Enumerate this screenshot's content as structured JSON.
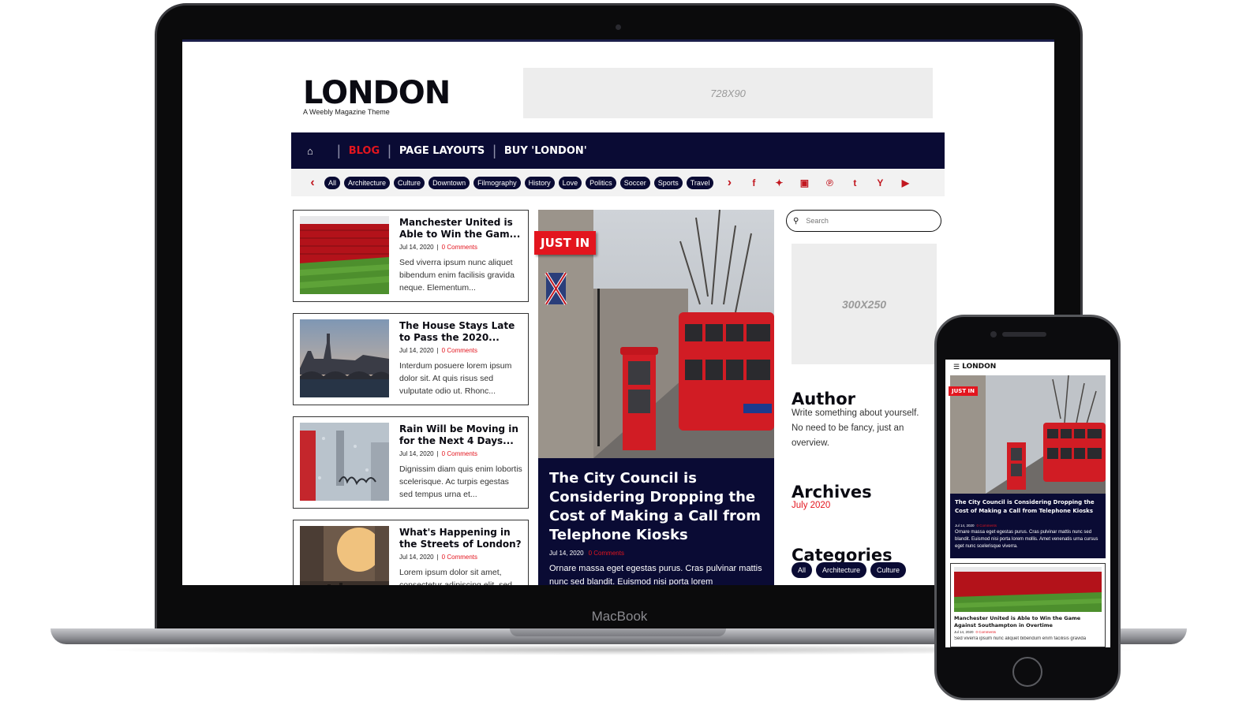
{
  "laptop": {
    "brand_label": "MacBook"
  },
  "site": {
    "logo": "LONDON",
    "tagline": "A Weebly Magazine Theme",
    "ad_top": "728X90",
    "nav": {
      "home_icon": "home-icon",
      "items": [
        "BLOG",
        "PAGE LAYOUTS",
        "BUY 'LONDON'"
      ],
      "active": "BLOG"
    },
    "tags": [
      "All",
      "Architecture",
      "Culture",
      "Downtown",
      "Filmography",
      "History",
      "Love",
      "Politics",
      "Soccer",
      "Sports",
      "Travel"
    ],
    "social_icons": [
      "facebook-icon",
      "twitter-icon",
      "instagram-icon",
      "pinterest-icon",
      "tumblr-icon",
      "hacker-news-icon",
      "youtube-icon"
    ],
    "posts": [
      {
        "title": "Manchester United is Able to Win the Gam...",
        "date": "Jul 14, 2020",
        "comments": "0 Comments",
        "excerpt": "Sed viverra ipsum nunc aliquet bibendum enim facilisis gravida neque. Elementum..."
      },
      {
        "title": "The House Stays Late to Pass the 2020...",
        "date": "Jul 14, 2020",
        "comments": "0 Comments",
        "excerpt": "Interdum posuere lorem ipsum dolor sit. At quis risus sed vulputate odio ut. Rhonc..."
      },
      {
        "title": "Rain Will be Moving in for the Next 4 Days...",
        "date": "Jul 14, 2020",
        "comments": "0 Comments",
        "excerpt": "Dignissim diam quis enim lobortis scelerisque. Ac turpis egestas sed tempus urna et..."
      },
      {
        "title": "What's Happening in the Streets of London?",
        "date": "Jul 14, 2020",
        "comments": "0 Comments",
        "excerpt": "Lorem ipsum dolor sit amet, consectetur adipiscing elit, sed"
      }
    ],
    "feature": {
      "badge": "JUST IN",
      "title": "The City Council is Considering Dropping the Cost of Making a Call from Telephone Kiosks",
      "date": "Jul 14, 2020",
      "comments": "0 Comments",
      "excerpt": "Ornare massa eget egestas purus. Cras pulvinar mattis nunc sed blandit. Euismod nisi porta lorem"
    },
    "sidebar": {
      "search_placeholder": "Search",
      "ad_side": "300X250",
      "author_heading": "Author",
      "author_line1": "Write something about yourself.",
      "author_line2": "No need to be fancy, just an",
      "author_line3": "overview.",
      "archives_heading": "Archives",
      "archive_link": "July 2020",
      "categories_heading": "Categories",
      "categories": [
        "All",
        "Architecture",
        "Culture"
      ]
    }
  },
  "mobile": {
    "logo": "LONDON",
    "feature": {
      "badge": "JUST IN",
      "title": "The City Council is Considering Dropping the Cost of Making a Call from Telephone Kiosks",
      "date": "Jul 14, 2020",
      "comments": "0 Comments",
      "excerpt": "Ornare massa eget egestas purus. Cras pulvinar mattis nunc sed blandit. Euismod nisi porta lorem mollis. Amet venenatis urna cursus eget nunc scelerisque viverra."
    },
    "card": {
      "title": "Manchester United is Able to Win the Game Against Southampton in Overtime",
      "date": "Jul 14, 2020",
      "comments": "0 Comments",
      "excerpt": "Sed viverra ipsum nunc aliquet bibendum enim facilisis gravida"
    }
  },
  "colors": {
    "navy": "#0a0b34",
    "accent_red": "#e3151e",
    "ad_gray": "#ededed"
  }
}
